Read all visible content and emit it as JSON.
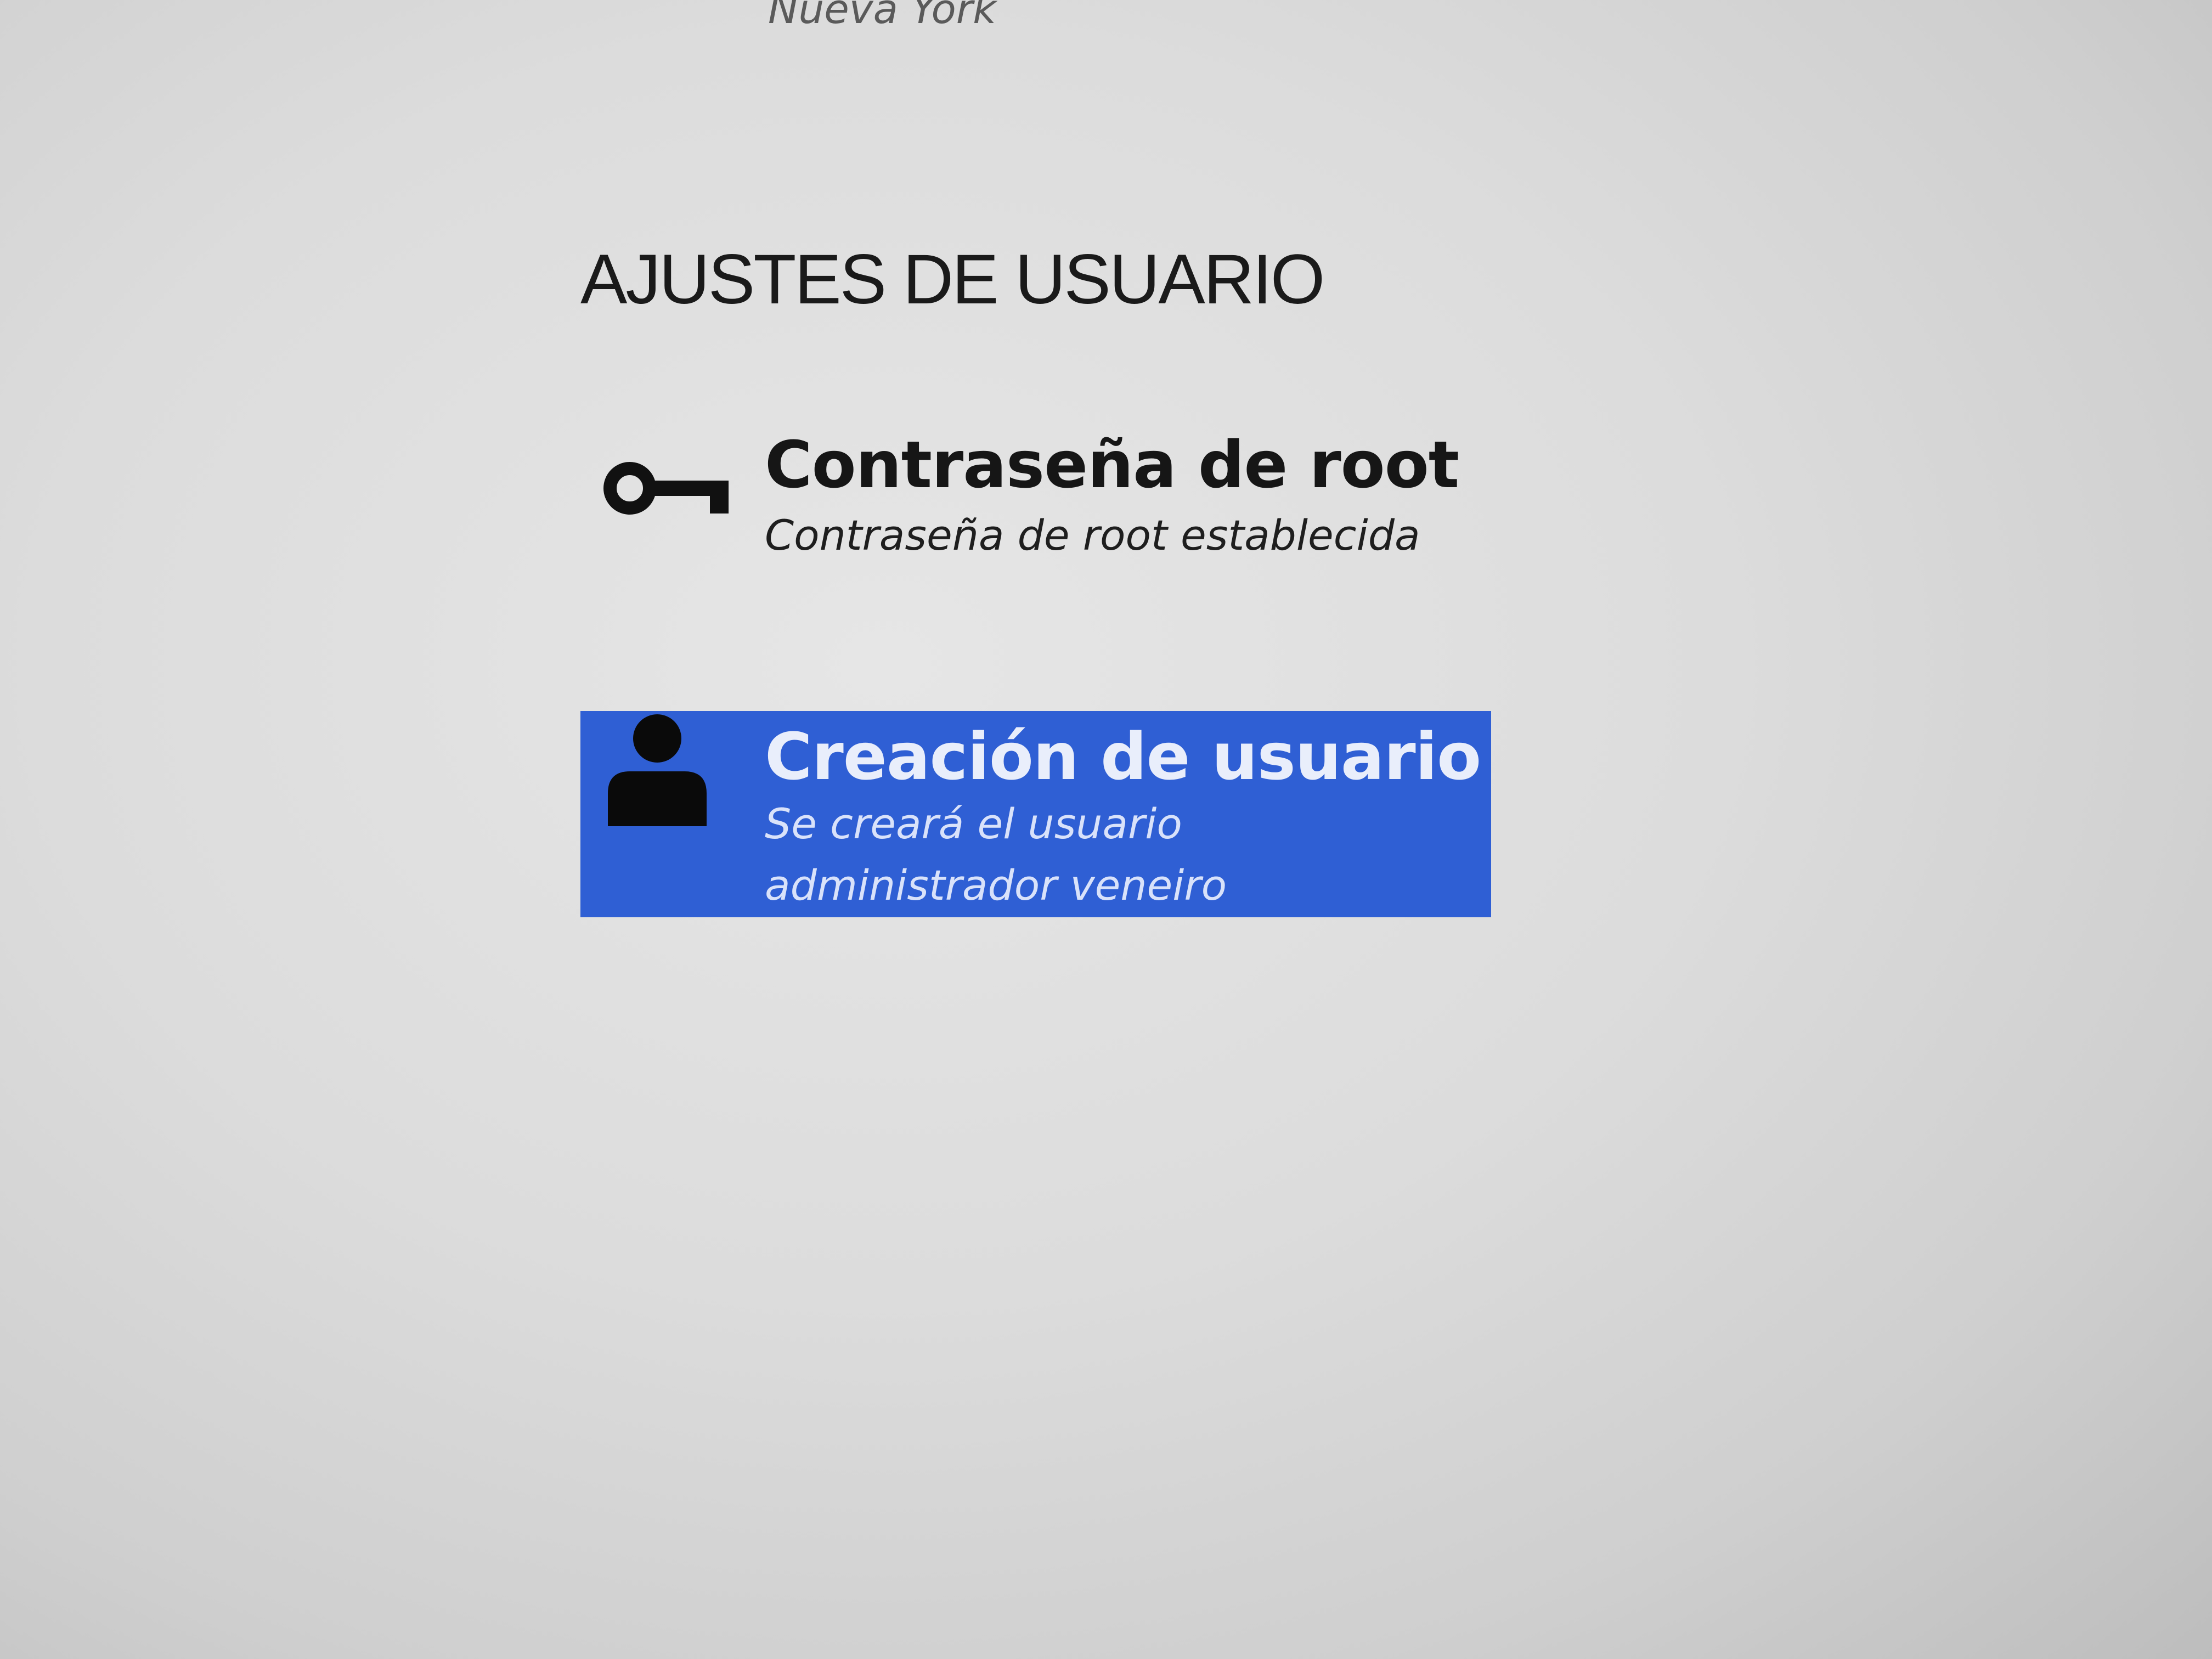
{
  "timezone": {
    "value": "Nueva York"
  },
  "user_settings": {
    "heading": "AJUSTES DE USUARIO",
    "root_password": {
      "icon": "key-icon",
      "title": "Contraseña de root",
      "status": "Contraseña de root establecida"
    },
    "user_creation": {
      "icon": "user-icon",
      "title": "Creación de usuario",
      "status": "Se creará el usuario\nadministrador veneiro",
      "selected": true,
      "highlight_color": "#2f5fd4"
    }
  }
}
